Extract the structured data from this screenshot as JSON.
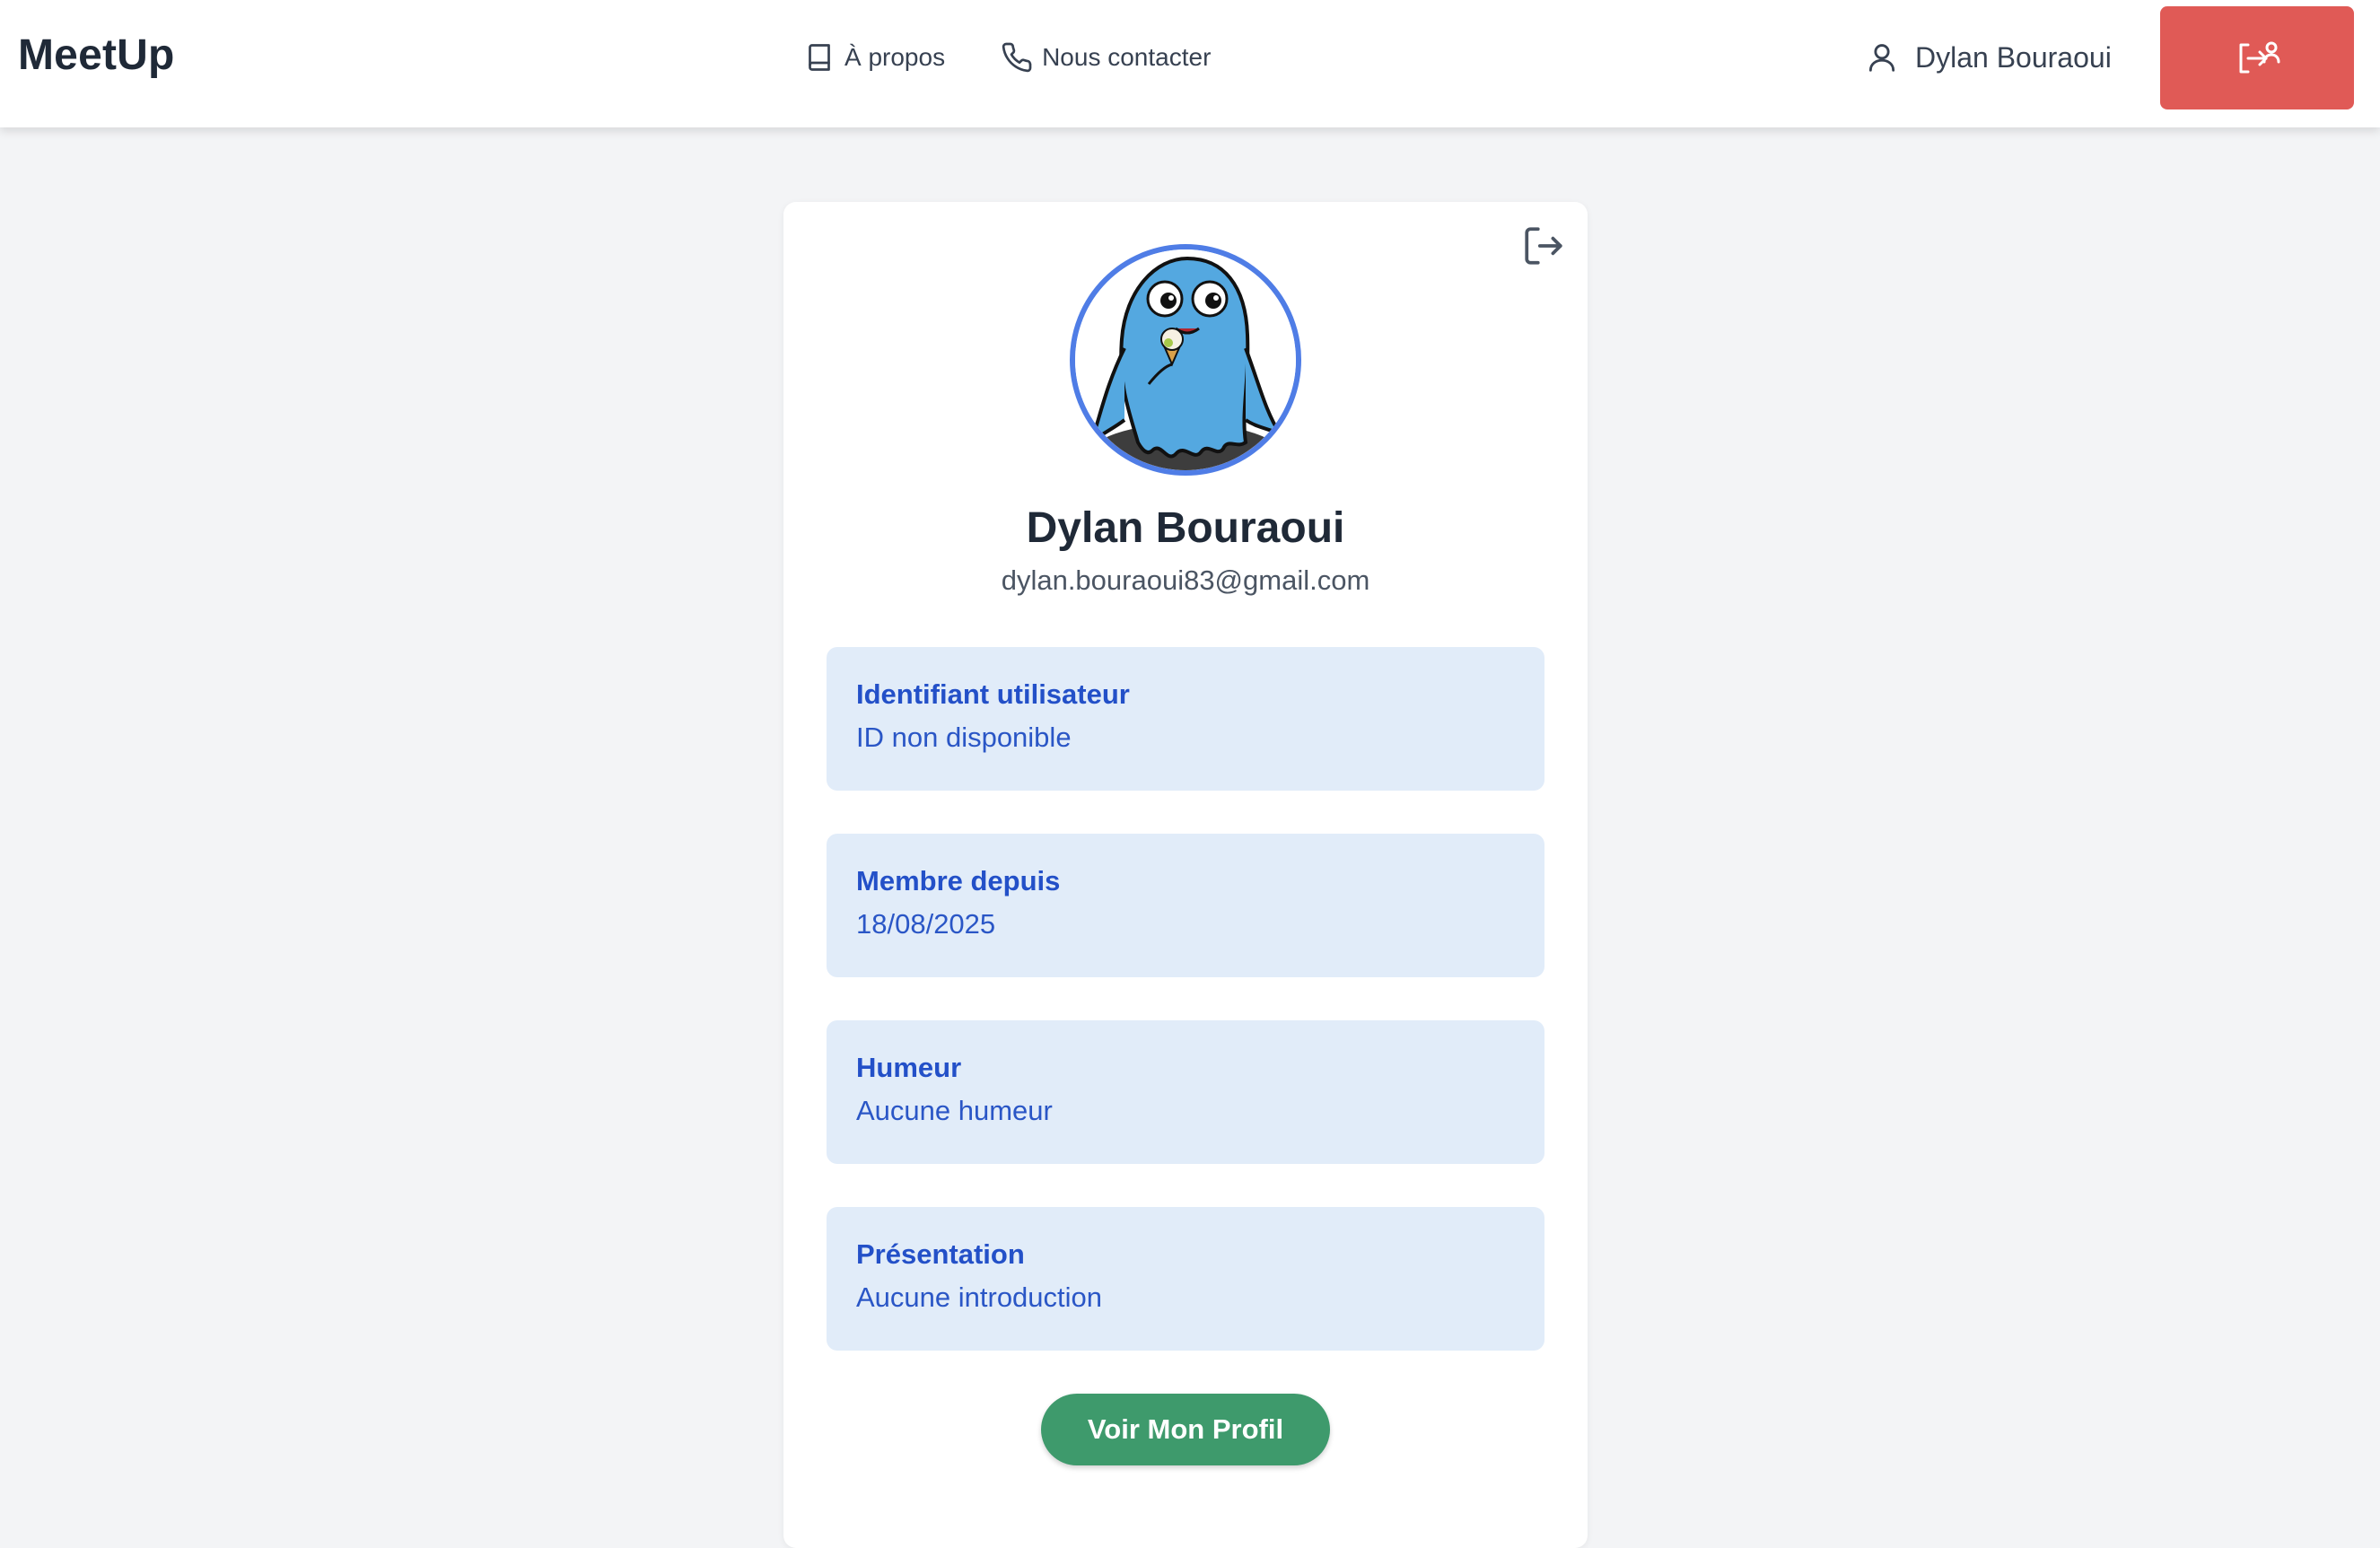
{
  "header": {
    "brand": "MeetUp",
    "nav": [
      {
        "label": "À propos",
        "icon": "book-icon"
      },
      {
        "label": "Nous contacter",
        "icon": "phone-icon"
      }
    ],
    "user_name": "Dylan Bouraoui",
    "logout_icon": "logout-user-icon"
  },
  "profile": {
    "name": "Dylan Bouraoui",
    "email": "dylan.bouraoui83@gmail.com",
    "fields": [
      {
        "label": "Identifiant utilisateur",
        "value": "ID non disponible"
      },
      {
        "label": "Membre depuis",
        "value": "18/08/2025"
      },
      {
        "label": "Humeur",
        "value": "Aucune humeur"
      },
      {
        "label": "Présentation",
        "value": "Aucune introduction"
      }
    ],
    "view_profile_button": "Voir Mon Profil"
  },
  "colors": {
    "logout_button": "#e05a56",
    "accent_blue": "#2350c8",
    "info_box_bg": "#e1ecf9",
    "primary_button": "#3e9a6c",
    "avatar_ring": "#4f7de6"
  }
}
